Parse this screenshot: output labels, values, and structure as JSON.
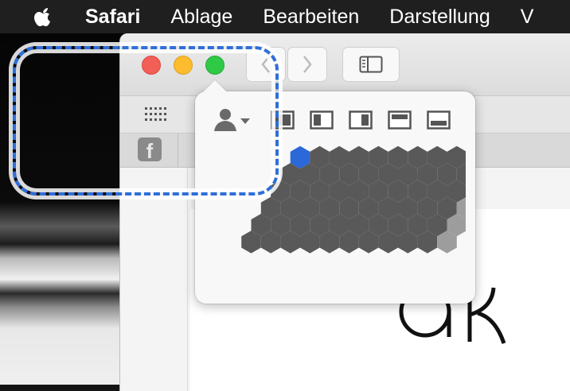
{
  "menubar": {
    "apple_icon": "apple-logo-icon",
    "app_name": "Safari",
    "items": [
      "Ablage",
      "Bearbeiten",
      "Darstellung",
      "V"
    ]
  },
  "window": {
    "toolbar": {
      "back_icon": "chevron-left-icon",
      "forward_icon": "chevron-right-icon",
      "sidebar_icon": "sidebar-icon"
    },
    "favorites_icon": "grid-dots-icon",
    "tab": {
      "favicon": "facebook-icon",
      "favicon_letter": "f"
    },
    "page_logo_text": "ak"
  },
  "tile_popover": {
    "account_icon": "person-icon",
    "layouts": [
      "fullscreen",
      "left-half",
      "right-half",
      "top-half",
      "bottom-half"
    ],
    "grid": {
      "columns": 11,
      "rows": 6,
      "selected_color": "#2b68d8",
      "active_color": "#595959",
      "inactive_color": "#9d9d9d"
    }
  },
  "highlight": {
    "color": "#2f6fd8"
  }
}
